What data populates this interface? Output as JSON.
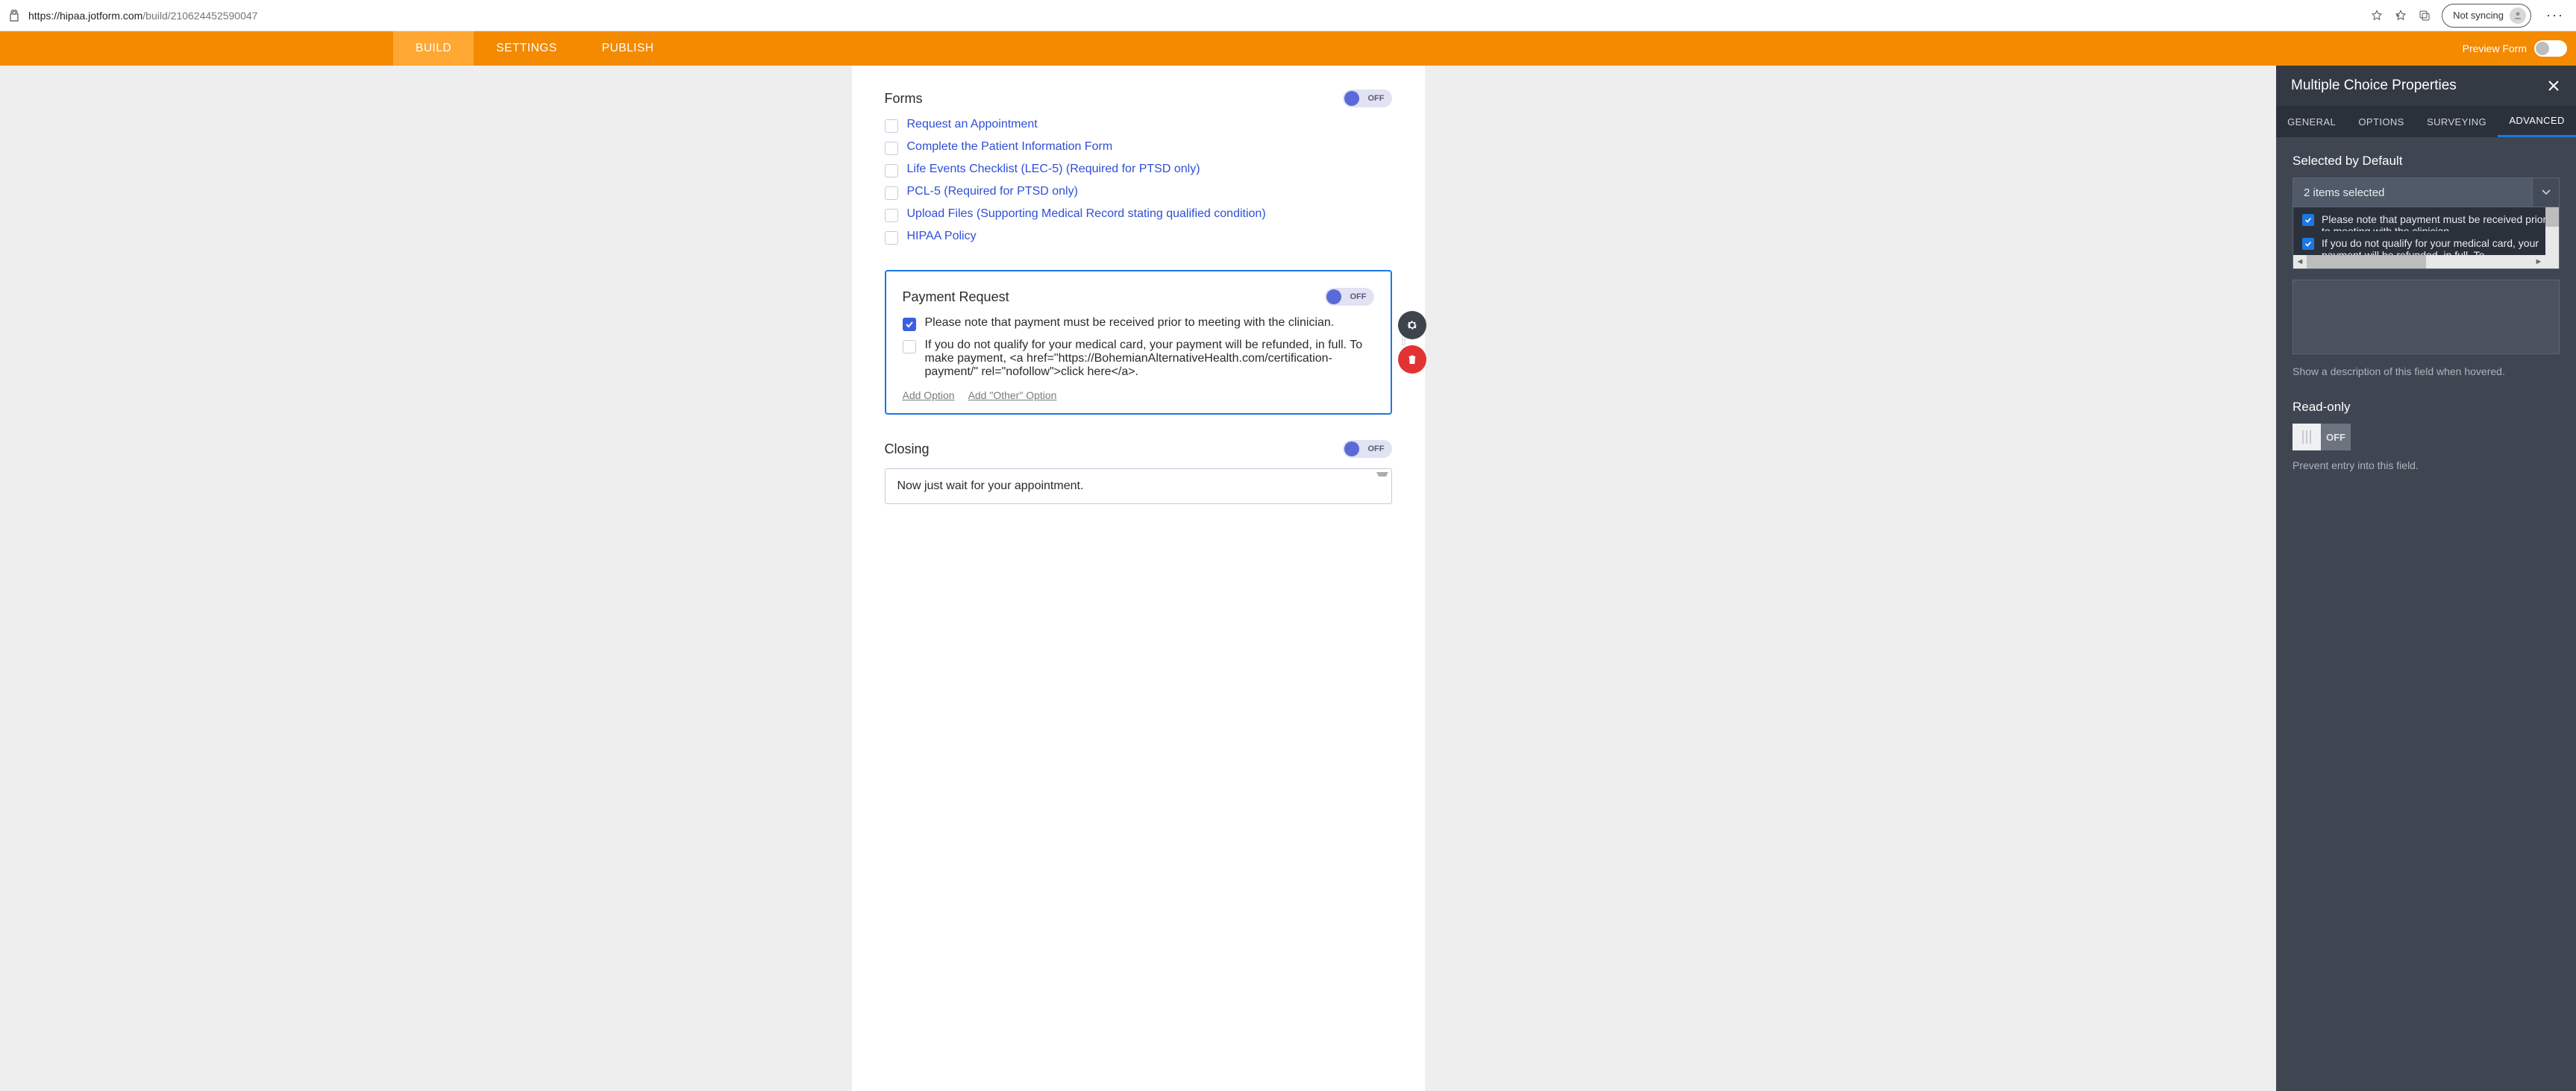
{
  "browser": {
    "url_base": "https://hipaa.jotform.com",
    "url_path": "/build/210624452590047",
    "sync_label": "Not syncing"
  },
  "nav": {
    "tabs": [
      "BUILD",
      "SETTINGS",
      "PUBLISH"
    ],
    "active_index": 0,
    "preview_label": "Preview Form"
  },
  "forms_field": {
    "title": "Forms",
    "toggle": "OFF",
    "options": [
      "Request an Appointment",
      "Complete the Patient Information Form",
      "Life Events Checklist (LEC-5) (Required for PTSD only)",
      "PCL-5 (Required for PTSD only)",
      "Upload Files (Supporting Medical Record stating qualified condition)",
      "HIPAA Policy"
    ]
  },
  "payment_field": {
    "title": "Payment Request",
    "toggle": "OFF",
    "options": [
      {
        "checked": true,
        "label": "Please note that payment must be received prior to meeting with the clinician."
      },
      {
        "checked": false,
        "label": "If you do not qualify for your medical card, your payment will be refunded, in full. To make payment, <a href=\"https://BohemianAlternativeHealth.com/certification-payment/\" rel=\"nofollow\">click here</a>."
      }
    ],
    "add_option": "Add Option",
    "add_other": "Add \"Other\" Option"
  },
  "closing_field": {
    "title": "Closing",
    "toggle": "OFF",
    "text": "Now just wait for your appointment."
  },
  "panel": {
    "title": "Multiple Choice Properties",
    "tabs": [
      "GENERAL",
      "OPTIONS",
      "SURVEYING",
      "ADVANCED"
    ],
    "active_tab": 3,
    "selected_default": {
      "title": "Selected by Default",
      "dropdown_label": "2 items selected",
      "items": [
        {
          "checked": true,
          "label": "Please note that payment must be received prior to meeting with the clinician."
        },
        {
          "checked": true,
          "label": "If you do not qualify for your medical card, your payment will be refunded, in full. To"
        }
      ]
    },
    "desc_hint": "Show a description of this field when hovered.",
    "readonly": {
      "title": "Read-only",
      "state": "OFF",
      "hint": "Prevent entry into this field."
    }
  }
}
